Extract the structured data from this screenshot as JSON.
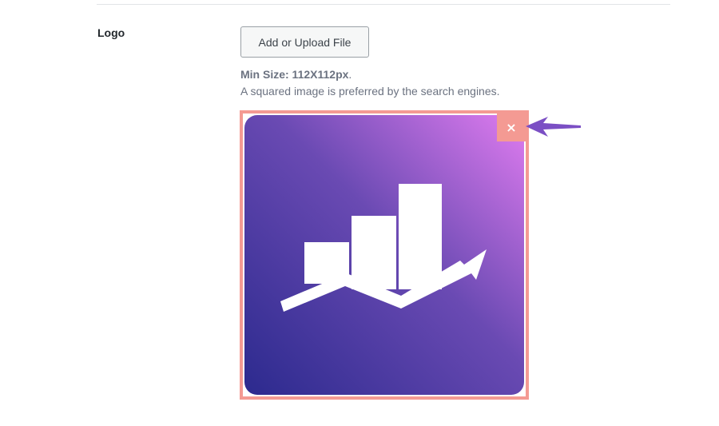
{
  "field": {
    "label": "Logo"
  },
  "upload": {
    "button_label": "Add or Upload File"
  },
  "hints": {
    "min_size_label": "Min Size: 112X112px",
    "min_size_suffix": ".",
    "description": "A squared image is preferred by the search engines."
  },
  "preview": {
    "remove_label": "×",
    "image_icon": "bar-chart-growth-logo",
    "gradient_colors": [
      "#2c2a8e",
      "#6a4ab3",
      "#e07cf0"
    ],
    "frame_color": "#f49a93"
  },
  "annotation": {
    "arrow_icon": "callout-arrow-icon",
    "arrow_color": "#7b4fc4"
  }
}
